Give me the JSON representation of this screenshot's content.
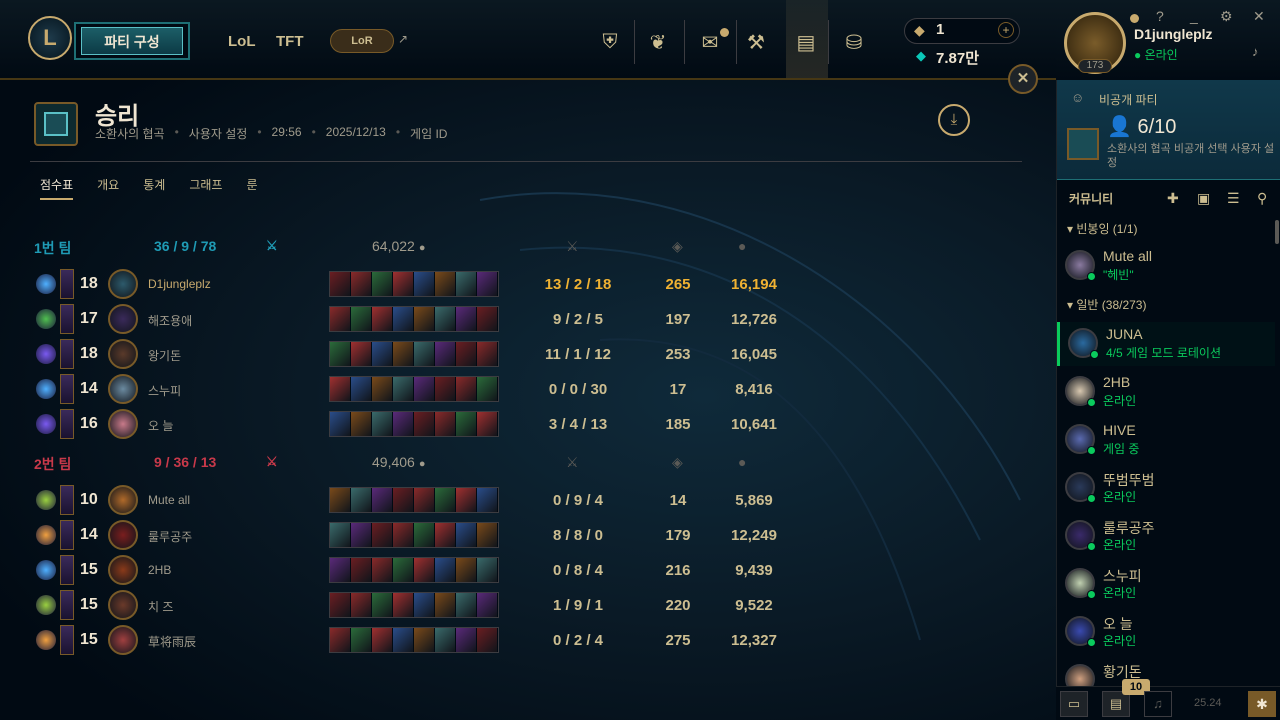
{
  "topbar": {
    "logo": "L",
    "party_button": "파티 구성",
    "nav_lol": "LoL",
    "nav_tft": "TFT",
    "nav_lor": "LoR",
    "ext_icon": "↗",
    "icons": [
      "trophy-icon",
      "rank-icon",
      "loot-icon",
      "tools-icon",
      "collection-icon",
      "store-icon"
    ],
    "currency1": "1",
    "currency1_plus": "+",
    "currency2": "7.87만",
    "window_min": "_",
    "window_help": "?",
    "window_settings": "⚙",
    "window_close": "✕"
  },
  "profile": {
    "name": "D1jungleplz",
    "status": "온라인",
    "level": "173"
  },
  "result": {
    "close": "✕",
    "title": "승리",
    "mode": "소환사의 협곡",
    "setting": "사용자 설정",
    "duration": "29:56",
    "date": "2025/12/13",
    "game_id": "게임 ID",
    "sep": "•"
  },
  "tabs": [
    "점수표",
    "개요",
    "통계",
    "그래프",
    "룬"
  ],
  "team1": {
    "name": "1번 팀",
    "kda": "36 / 9 / 78",
    "gold": "64,022",
    "players": [
      {
        "level": "18",
        "name": "D1jungleplz",
        "kda": "13 / 2 / 18",
        "cs": "265",
        "gold": "16,194"
      },
      {
        "level": "17",
        "name": "해조용애",
        "kda": "9 / 2 / 5",
        "cs": "197",
        "gold": "12,726"
      },
      {
        "level": "18",
        "name": "왕기돈",
        "kda": "11 / 1 / 12",
        "cs": "253",
        "gold": "16,045"
      },
      {
        "level": "14",
        "name": "스누피",
        "kda": "0 / 0 / 30",
        "cs": "17",
        "gold": "8,416"
      },
      {
        "level": "16",
        "name": "오 늘",
        "kda": "3 / 4 / 13",
        "cs": "185",
        "gold": "10,641"
      }
    ]
  },
  "team2": {
    "name": "2번 팀",
    "kda": "9 / 36 / 13",
    "gold": "49,406",
    "players": [
      {
        "level": "10",
        "name": "Mute all",
        "kda": "0 / 9 / 4",
        "cs": "14",
        "gold": "5,869"
      },
      {
        "level": "14",
        "name": "룰루공주",
        "kda": "8 / 8 / 0",
        "cs": "179",
        "gold": "12,249"
      },
      {
        "level": "15",
        "name": "2HB",
        "kda": "0 / 8 / 4",
        "cs": "216",
        "gold": "9,439"
      },
      {
        "level": "15",
        "name": "치 즈",
        "kda": "1 / 9 / 1",
        "cs": "220",
        "gold": "9,522"
      },
      {
        "level": "15",
        "name": "草将雨辰",
        "kda": "0 / 2 / 4",
        "cs": "275",
        "gold": "12,327"
      }
    ]
  },
  "sidebar": {
    "party_title": "비공개 파티",
    "party_count": "6/10",
    "party_desc": "소환사의 협곡 비공개 선택 사용자 설정",
    "community": "커뮤니티",
    "group1": "▾ 빈봉잉 (1/1)",
    "group2": "▾ 일반 (38/273)",
    "friends": [
      {
        "name": "Mute all",
        "status": "\"헤빈\""
      },
      {
        "name": "JUNA",
        "status": "4/5 게임 모드 로테이션"
      },
      {
        "name": "2HB",
        "status": "온라인"
      },
      {
        "name": "HIVE",
        "status": "게임 중"
      },
      {
        "name": "뚜범뚜범",
        "status": "온라인"
      },
      {
        "name": "룰루공주",
        "status": "온라인"
      },
      {
        "name": "스누피",
        "status": "온라인"
      },
      {
        "name": "오 늘",
        "status": "온라인"
      },
      {
        "name": "황기돈",
        "status": ""
      }
    ],
    "badge": "10",
    "version": "25.24"
  }
}
